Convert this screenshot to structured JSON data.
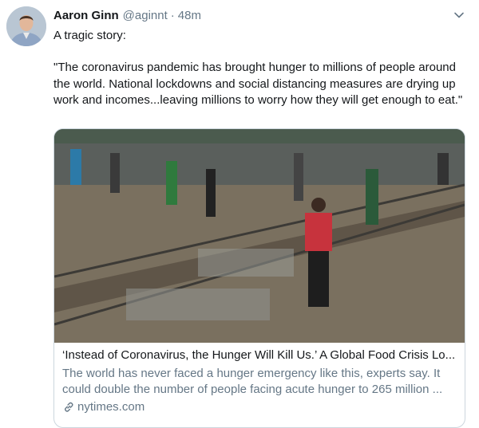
{
  "tweet": {
    "author_name": "Aaron Ginn",
    "handle": "@aginnt",
    "separator": "·",
    "time": "48m",
    "line1": "A tragic story:",
    "quote": "\"The coronavirus pandemic has brought hunger to millions of people around the world. National lockdowns and social distancing measures are drying up work and incomes...leaving millions to worry how they will get enough to eat.\""
  },
  "card": {
    "title": "‘Instead of Coronavirus, the Hunger Will Kill Us.’ A Global Food Crisis Lo...",
    "description": "The world has never faced a hunger emergency like this, experts say. It could double the number of people facing acute hunger to 265 million ...",
    "domain": "nytimes.com"
  },
  "icons": {
    "caret": "chevron-down-icon",
    "link": "link-icon"
  },
  "colors": {
    "text_primary": "#14171a",
    "text_secondary": "#657786",
    "card_border": "#ccd6dd"
  }
}
